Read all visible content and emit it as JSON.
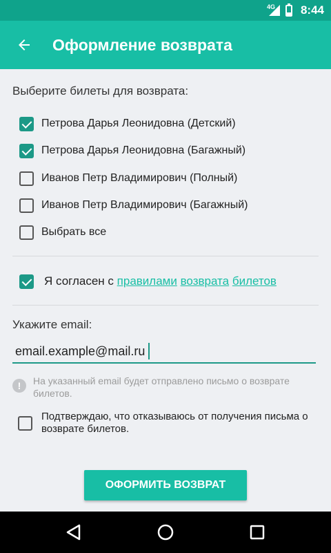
{
  "status_bar": {
    "network": "4G",
    "time": "8:44",
    "battery_level": 0.3
  },
  "app_bar": {
    "title": "Оформление возврата",
    "back_icon": "arrow-left-icon"
  },
  "tickets_section": {
    "label": "Выберите билеты для возврата:",
    "items": [
      {
        "label": "Петрова Дарья Леонидовна (Детский)",
        "checked": true
      },
      {
        "label": "Петрова Дарья Леонидовна (Багажный)",
        "checked": true
      },
      {
        "label": "Иванов Петр Владимирович (Полный)",
        "checked": false
      },
      {
        "label": "Иванов Петр Владимирович (Багажный)",
        "checked": false
      }
    ],
    "select_all": {
      "label": "Выбрать все",
      "checked": false
    }
  },
  "agreement": {
    "checked": true,
    "text": "Я согласен с",
    "link1": "правилами",
    "link2": "возврата",
    "link3": "билетов"
  },
  "email": {
    "label": "Укажите email:",
    "value": "email.example@mail.ru",
    "info": "На указанный email будет отправлено письмо о возврате билетов."
  },
  "confirm": {
    "checked": false,
    "label": "Подтверждаю, что отказываюсь от получения письма о возврате билетов."
  },
  "submit_label": "ОФОРМИТЬ ВОЗВРАТ",
  "colors": {
    "primary": "#18bea5",
    "primary_dark": "#0fa38b",
    "checkbox": "#1c9987"
  }
}
